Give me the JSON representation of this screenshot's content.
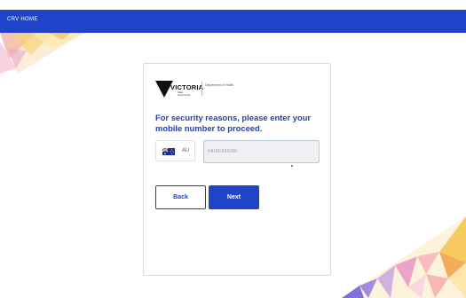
{
  "header": {
    "home_label": "CRV HOME"
  },
  "colors": {
    "primary": "#1f44c9",
    "heading": "#1f3fc2",
    "error_dot": "#e0102a"
  },
  "logo": {
    "wordmark": "VICTORIA",
    "subtext": "State Government",
    "department": "Department of Health"
  },
  "form": {
    "heading": "For security reasons, please enter your mobile number to proceed.",
    "country_code": "AU",
    "phone_placeholder": "0400000000"
  },
  "buttons": {
    "back_label": "Back",
    "next_label": "Next"
  },
  "icons": {
    "flag": "australia-flag-icon",
    "logo": "victoria-triangle-logo"
  }
}
